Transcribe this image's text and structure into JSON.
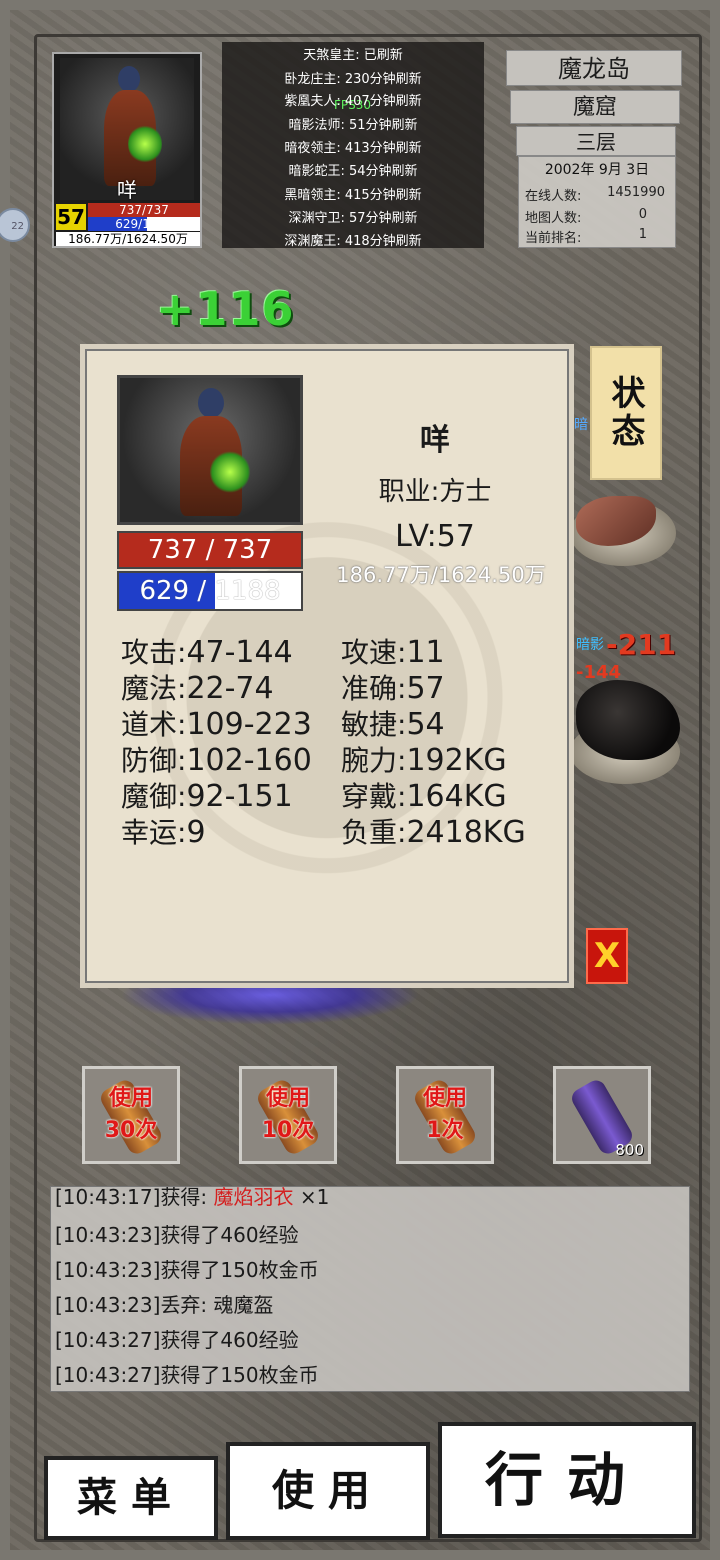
{
  "hud": {
    "player_name": "咩",
    "level": "57",
    "hp": "737/737",
    "mp_current": "629",
    "mp_max": "1188",
    "mp_text": "629/1188",
    "mp_fraction": 0.53,
    "exp": "186.77万/1624.50万"
  },
  "boss_list": {
    "fps": "FPS30",
    "items": [
      "天煞皇主: 已刷新",
      "卧龙庄主: 230分钟刷新",
      "紫凰夫人: 407分钟刷新",
      "暗影法师: 51分钟刷新",
      "暗夜领主: 413分钟刷新",
      "暗影蛇王: 54分钟刷新",
      "黑暗领主: 415分钟刷新",
      "深渊守卫: 57分钟刷新",
      "深渊魔王: 418分钟刷新"
    ]
  },
  "location": {
    "map": "魔龙岛",
    "zone": "魔窟",
    "floor": "三层",
    "date": "2002年 9月 3日",
    "online_label": "在线人数:",
    "online_value": "1451990",
    "map_players_label": "地图人数:",
    "map_players_value": "0",
    "rank_label": "当前排名:",
    "rank_value": "1"
  },
  "floating_number": "+116",
  "field": {
    "mob_tag_1": "暗",
    "mob_tag_2": "暗影",
    "damage_big": "-211",
    "damage_small": "-144",
    "side_badge": "22"
  },
  "status_tab": "状态",
  "close_label": "X",
  "sheet": {
    "name": "咩",
    "job": "职业:方士",
    "lv_label": "LV:",
    "lv_value": "57",
    "hp_text": "737 / 737",
    "mp_text": "629 / 1188",
    "mp_fraction": 0.53,
    "exp": "186.77万/1624.50万",
    "stats_left": [
      {
        "label": "攻击:",
        "value": "47-144"
      },
      {
        "label": "魔法:",
        "value": "22-74"
      },
      {
        "label": "道术:",
        "value": "109-223"
      },
      {
        "label": "防御:",
        "value": "102-160"
      },
      {
        "label": "魔御:",
        "value": "92-151"
      },
      {
        "label": "幸运:",
        "value": "9"
      }
    ],
    "stats_right": [
      {
        "label": "攻速:",
        "value": "11"
      },
      {
        "label": "准确:",
        "value": "57"
      },
      {
        "label": "敏捷:",
        "value": "54"
      },
      {
        "label": "腕力:",
        "value": "192KG"
      },
      {
        "label": "穿戴:",
        "value": "164KG"
      },
      {
        "label": "负重:",
        "value": "2418KG"
      }
    ]
  },
  "items": [
    {
      "label_1": "使用",
      "label_2": "30次"
    },
    {
      "label_1": "使用",
      "label_2": "10次"
    },
    {
      "label_1": "使用",
      "label_2": "1次"
    },
    {
      "count": "800"
    }
  ],
  "log": [
    {
      "time": "[10:43:17]",
      "text": "获得: ",
      "highlight": "魔焰羽衣",
      "suffix": " ×1"
    },
    {
      "time": "[10:43:23]",
      "text": "获得了460经验"
    },
    {
      "time": "[10:43:23]",
      "text": "获得了150枚金币"
    },
    {
      "time": "[10:43:23]",
      "text": "丢弃: 魂魔盔"
    },
    {
      "time": "[10:43:27]",
      "text": "获得了460经验"
    },
    {
      "time": "[10:43:27]",
      "text": "获得了150枚金币"
    }
  ],
  "buttons": {
    "menu": "菜单",
    "use": "使用",
    "action": "行动"
  }
}
